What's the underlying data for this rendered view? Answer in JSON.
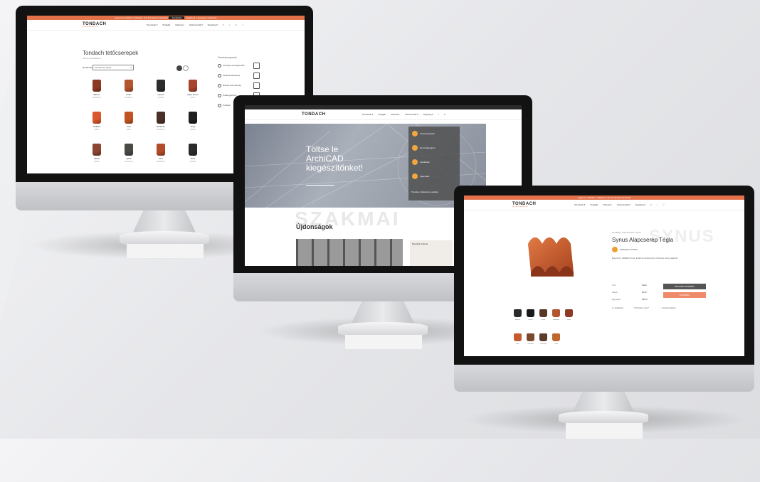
{
  "monitor1": {
    "topbar_text": "Ingyenes szállítás 1 raklaptól, már Dunakeszin átvehető",
    "topbar_selected": "Aktuálisak",
    "topbar_links": [
      "Cégeknek",
      "Lakossági",
      "Kapcsolat"
    ],
    "logo": "TONDACH",
    "logo_sub": "WIENERBERGER",
    "nav": [
      "Termékek ▾",
      "Szolgált.",
      "Referenc.",
      "Referenciák ▾",
      "Segítség ▾"
    ],
    "title": "Tondach tetőcserepek",
    "subtitle": "48 termék található",
    "filter_label": "Rendezés",
    "filter_value": "Kiemelt termékek",
    "tiles": [
      {
        "name": "Balance",
        "sub": "Natúrpiros",
        "color": "#8b3a22"
      },
      {
        "name": "Rustic",
        "sub": "Rézbarna",
        "color": "#b3552e"
      },
      {
        "name": "Carisma",
        "sub": "Antracit",
        "color": "#2d2d2d"
      },
      {
        "name": "Figaro Deluxe",
        "sub": "Vörös",
        "color": "#a8442a"
      },
      {
        "name": "Hódfarkú",
        "sub": "Natúr",
        "color": "#d9572c"
      },
      {
        "name": "Zenit",
        "sub": "Natúr",
        "color": "#c25424"
      },
      {
        "name": "Mediterrán",
        "sub": "Rézbarna",
        "color": "#4a3026"
      },
      {
        "name": "Tangó",
        "sub": "Fekete",
        "color": "#1f1f1f"
      },
      {
        "name": "Sabbia",
        "sub": "Barna",
        "color": "#8c4530"
      },
      {
        "name": "Sybille",
        "sub": "Gesztenye",
        "color": "#4b4944"
      },
      {
        "name": "Zenit",
        "sub": "Natúrpiros",
        "color": "#b34a29"
      },
      {
        "name": "Stella",
        "sub": "Antracit",
        "color": "#2b2b2b"
      }
    ],
    "sidebar_title": "Termékcsoportok",
    "sidebar_items": [
      "Cserepek és kiegészítők",
      "Kerámia tetőcserép",
      "Bramac betoncserép",
      "Tetőkiegészítők",
      "Tetőfólia"
    ]
  },
  "monitor2": {
    "logo": "TONDACH",
    "nav": [
      "Termékek ▾",
      "Szolgált.",
      "Referenc.",
      "Referenciák ▾",
      "Segítség ▾"
    ],
    "hero_text": "Töltse le ArchiCAD kiegészítőnket!",
    "panel_items": [
      "Cserépvarázsló",
      "Tervezőprogram",
      "Letöltések",
      "Kapcsolat"
    ],
    "panel_note": "Tervezés, kivitelezés, segítség",
    "watermark": "SZAKMAI",
    "section_title": "Újdonságok",
    "card_text": "Megújult Ardesia"
  },
  "monitor3": {
    "topbar_text": "Ingyenes szállítás 1 raklaptól, már Dunakeszin átvehető",
    "logo": "TONDACH",
    "logo_sub": "WIENERBERGER",
    "nav": [
      "Termékek ▾",
      "Szolgált.",
      "Referenc.",
      "Referenciák ▾",
      "Segítség ▾"
    ],
    "breadcrumb": "Kezdőlap / Tetőcserepek / Synus",
    "watermark": "SYNUS",
    "product_title": "Synus Alapcserép Tégla",
    "badge": "Natúrpiros színben",
    "description": "Egyszerű, időtálló forma, kiváló ár-érték arány, bármely tetőre ajánlott.",
    "options": [
      {
        "label": "Szín",
        "value": "Natúr"
      },
      {
        "label": "Darab",
        "value": "db/m²"
      },
      {
        "label": "Egységár",
        "value": "489 Ft"
      }
    ],
    "btn_calc": "ÁRAJÁNLATKÉRÉS",
    "btn_cart": "KOSÁRBA",
    "actions": [
      "Letöltések",
      "Kérdése van?",
      "Kedvencekhez"
    ],
    "swatches": [
      {
        "name": "Antracit",
        "color": "#2b2b2b"
      },
      {
        "name": "Fekete",
        "color": "#1a1a1a"
      },
      {
        "name": "Barna",
        "color": "#5a3528"
      },
      {
        "name": "Natúrpiros",
        "color": "#b4542f"
      },
      {
        "name": "Vörös",
        "color": "#8e3b25"
      },
      {
        "name": "Natúr",
        "color": "#c55a2d"
      },
      {
        "name": "Rézbarna",
        "color": "#7a4a2e"
      },
      {
        "name": "Gesztenye",
        "color": "#5b3c2c"
      },
      {
        "name": "Tégla",
        "color": "#c0662f"
      }
    ]
  }
}
